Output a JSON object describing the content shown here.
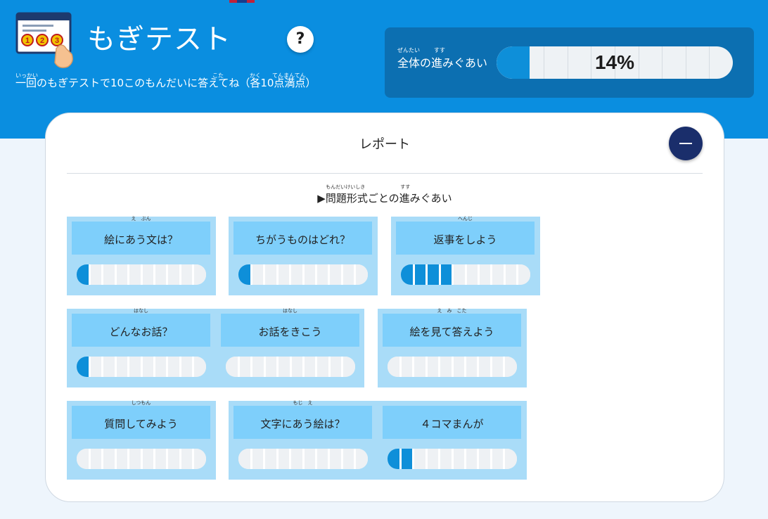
{
  "app": {
    "title": "もぎテスト",
    "help_label": "?",
    "subtitle": "一回のもぎテストで10このもんだいに答えてね（各10点満点）",
    "subtitle_ruby": [
      "いっかい",
      "こた",
      "かく",
      "てんまんてん"
    ]
  },
  "overall": {
    "label": "全体の進みぐあい",
    "label_ruby": [
      "ぜんたい",
      "すす"
    ],
    "percent_text": "14%",
    "percent": 14
  },
  "report": {
    "title": "レポート",
    "collapse_label": "−",
    "section_heading": "▶問題形式ごとの進みぐあい",
    "section_ruby": [
      "もんだいけいしき",
      "すす"
    ]
  },
  "categories": [
    {
      "label": "絵にあう文は？",
      "ruby": [
        "え",
        "ぶん"
      ],
      "completed": 1,
      "total": 10
    },
    {
      "label": "ちがうものはどれ？",
      "ruby": [],
      "completed": 1,
      "total": 10
    },
    {
      "label": "返事をしよう",
      "ruby": [
        "へんじ"
      ],
      "completed": 4,
      "total": 10
    },
    {
      "label": "どんなお話？",
      "ruby": [
        "はなし"
      ],
      "completed": 1,
      "total": 10
    },
    {
      "label": "お話をきこう",
      "ruby": [
        "はなし"
      ],
      "completed": 0,
      "total": 10
    },
    {
      "label": "絵を見て答えよう",
      "ruby": [
        "え",
        "み",
        "こた"
      ],
      "completed": 0,
      "total": 10
    },
    {
      "label": "質問してみよう",
      "ruby": [
        "しつもん"
      ],
      "completed": 0,
      "total": 10
    },
    {
      "label": "文字にあう絵は？",
      "ruby": [
        "もじ",
        "え"
      ],
      "completed": 0,
      "total": 10
    },
    {
      "label": "４コマまんが",
      "ruby": [],
      "completed": 2,
      "total": 10
    }
  ],
  "colors": {
    "header": "#0a8ee0",
    "progress_fill": "#0e8fd9",
    "card_bg": "#a9dcf8",
    "label_bg": "#7ecffb",
    "collapse_btn": "#1a2e6b"
  }
}
